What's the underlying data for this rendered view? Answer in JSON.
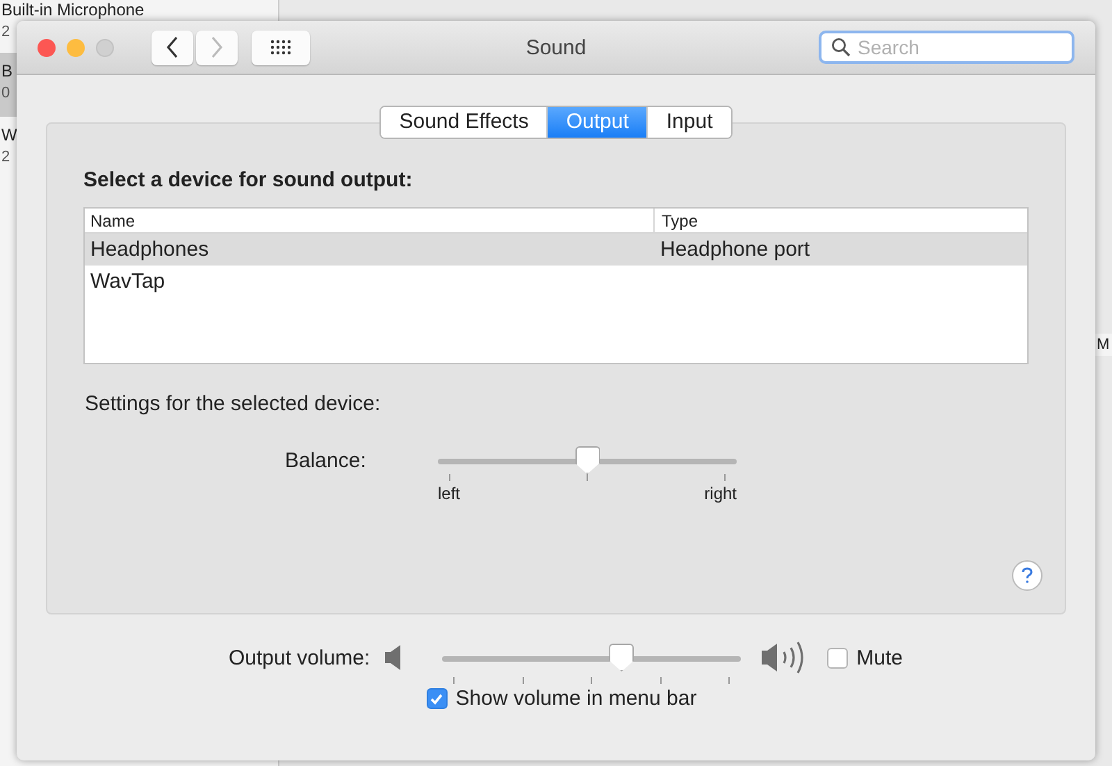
{
  "background_window": {
    "list_items": [
      {
        "title": "Built-in Microphone",
        "subtitle": "2",
        "selected": false
      },
      {
        "title": "B",
        "subtitle": "0",
        "selected": true
      },
      {
        "title": "W",
        "subtitle": "2",
        "selected": false
      }
    ],
    "column_header": "M"
  },
  "window": {
    "title": "Sound"
  },
  "search": {
    "placeholder": "Search"
  },
  "tabs": [
    {
      "label": "Sound Effects",
      "selected": false
    },
    {
      "label": "Output",
      "selected": true
    },
    {
      "label": "Input",
      "selected": false
    }
  ],
  "output": {
    "heading": "Select a device for sound output:",
    "columns": [
      "Name",
      "Type"
    ],
    "rows": [
      {
        "name": "Headphones",
        "type": "Headphone port",
        "selected": true
      },
      {
        "name": "WavTap",
        "selected": false
      }
    ],
    "settings_label": "Settings for the selected device:",
    "balance": {
      "label": "Balance:",
      "level": 0.5,
      "left": "left",
      "right": "right"
    }
  },
  "volume": {
    "label": "Output volume:",
    "level": 0.6,
    "mute": {
      "label": "Mute",
      "checked": false
    }
  },
  "show_in_menu_bar": {
    "label": "Show volume in menu bar",
    "checked": true
  }
}
